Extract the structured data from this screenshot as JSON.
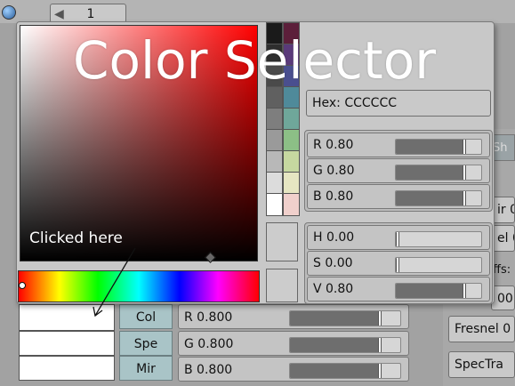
{
  "header": {
    "page_number": "1"
  },
  "popup": {
    "title": "Color Selector",
    "hex": "Hex: CCCCCC",
    "rgb": [
      {
        "label": "R 0.80",
        "value": 0.8
      },
      {
        "label": "G 0.80",
        "value": 0.8
      },
      {
        "label": "B 0.80",
        "value": 0.8
      }
    ],
    "hsv": [
      {
        "label": "H 0.00",
        "value": 0.0
      },
      {
        "label": "S 0.00",
        "value": 0.0
      },
      {
        "label": "V 0.80",
        "value": 0.8
      }
    ],
    "annotation": "Clicked here",
    "palette_colors": [
      "#1a1a1a",
      "#5c1f3a",
      "#2e2e2e",
      "#5a3a7a",
      "#4a4a4a",
      "#4a4f8f",
      "#606060",
      "#4f8a9a",
      "#7e7e7e",
      "#6fa79a",
      "#9a9a9a",
      "#8cbf86",
      "#b8b8b8",
      "#c6d8a0",
      "#dcdcdc",
      "#e6e6c2",
      "#ffffff",
      "#f0d0cc"
    ],
    "current_color": "#cccccc",
    "previous_color": "#cccccc"
  },
  "material": {
    "tabs": [
      "Col",
      "Spe",
      "Mir"
    ],
    "rows": [
      {
        "label": "R 0.800",
        "value": 0.8
      },
      {
        "label": "G 0.800",
        "value": 0.8
      },
      {
        "label": "B 0.800",
        "value": 0.8
      }
    ]
  },
  "right_panel": {
    "partial_labels": [
      "Sh",
      "ir 0",
      "el 0",
      "ffs:",
      "00"
    ],
    "fresnel": "Fresnel 0",
    "spectra": "SpecTra"
  }
}
